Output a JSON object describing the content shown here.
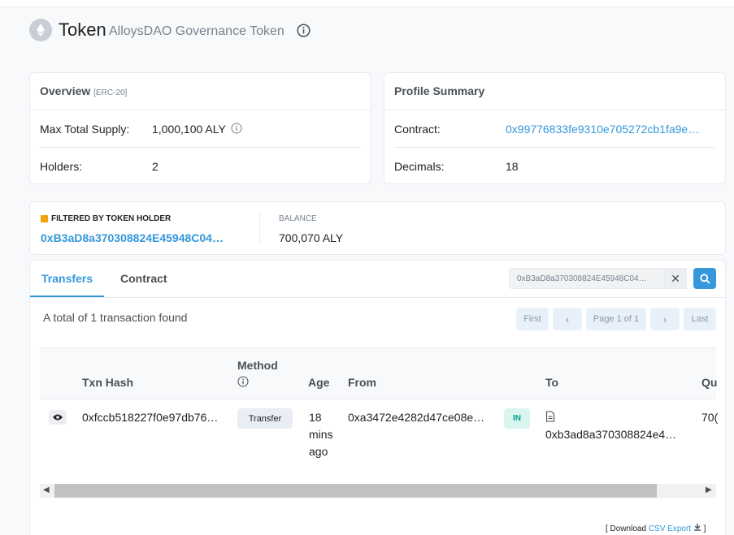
{
  "header": {
    "title": "Token",
    "subtitle": "AlloysDAO Governance Token"
  },
  "overview": {
    "title": "Overview",
    "standard": "[ERC-20]",
    "max_supply_label": "Max Total Supply:",
    "max_supply_value": "1,000,100 ALY",
    "holders_label": "Holders:",
    "holders_value": "2"
  },
  "profile": {
    "title": "Profile Summary",
    "contract_label": "Contract:",
    "contract_value": "0x99776833fe9310e705272cb1fa9e…",
    "decimals_label": "Decimals:",
    "decimals_value": "18"
  },
  "filter": {
    "title": "FILTERED BY TOKEN HOLDER",
    "address": "0xB3aD8a370308824E45948C04…",
    "balance_label": "BALANCE",
    "balance_value": "700,070 ALY"
  },
  "tabs": [
    {
      "label": "Transfers",
      "active": true
    },
    {
      "label": "Contract",
      "active": false
    }
  ],
  "search": {
    "value": "0xB3aD8a370308824E45948C04…"
  },
  "summary": "A total of 1 transaction found",
  "pagination": {
    "first": "First",
    "prev": "‹",
    "page": "Page 1 of 1",
    "next": "›",
    "last": "Last"
  },
  "table": {
    "columns": {
      "txn_hash": "Txn Hash",
      "method": "Method",
      "age": "Age",
      "from": "From",
      "to": "To",
      "quantity": "Qu"
    },
    "rows": [
      {
        "txn_hash": "0xfccb518227f0e97db76…",
        "method": "Transfer",
        "age_1": "18",
        "age_2": "mins",
        "age_3": "ago",
        "from": "0xa3472e4282d47ce08e…",
        "direction": "IN",
        "to": "0xb3ad8a370308824e4…",
        "quantity": "70("
      }
    ]
  },
  "download": {
    "prefix": "[ Download",
    "link": "CSV Export",
    "suffix": "]"
  },
  "colors": {
    "accent": "#3498db",
    "in_badge_bg": "#daf5ef",
    "in_badge_text": "#00a186"
  }
}
